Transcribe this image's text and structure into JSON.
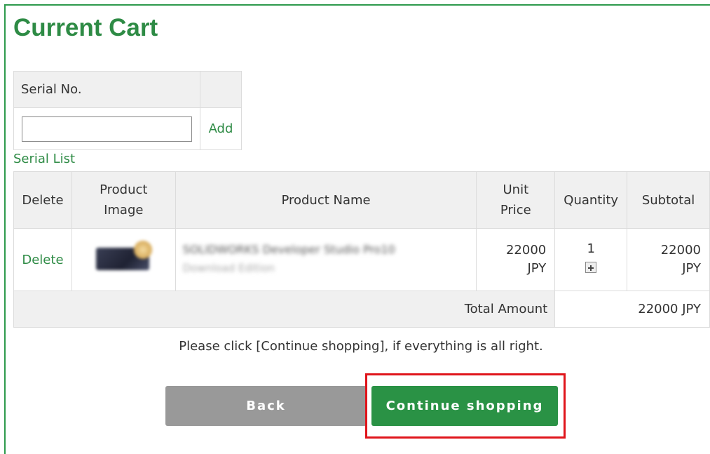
{
  "page": {
    "title": "Current Cart"
  },
  "serial": {
    "header": "Serial No.",
    "input_value": "",
    "add_label": "Add",
    "list_link": "Serial List"
  },
  "cart": {
    "columns": {
      "delete": "Delete",
      "image": "Product Image",
      "name": "Product Name",
      "unit_price": "Unit Price",
      "quantity": "Quantity",
      "subtotal": "Subtotal"
    },
    "items": [
      {
        "delete_label": "Delete",
        "name": "SOLIDWORKS Developer Studio Pro10",
        "subname": "Download Edition",
        "unit_price": "22000 JPY",
        "quantity": "1",
        "subtotal": "22000 JPY"
      }
    ],
    "total_label": "Total Amount",
    "total_value": "22000 JPY"
  },
  "instruction": "Please click [Continue shopping], if everything is all right.",
  "buttons": {
    "back": "Back",
    "continue": "Continue shopping"
  },
  "colors": {
    "accent": "#2e8b45",
    "button_green": "#2a9245",
    "button_gray": "#999999",
    "highlight": "#e0151b"
  }
}
